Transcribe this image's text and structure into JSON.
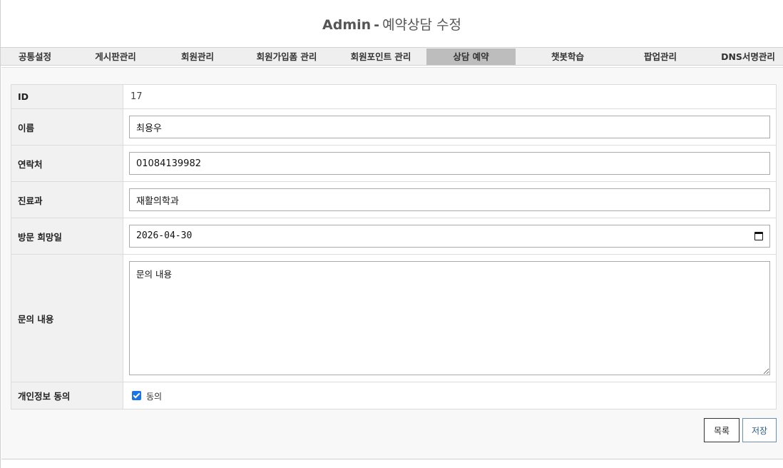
{
  "header": {
    "brand": "Admin",
    "separator": "-",
    "title": "예약상담 수정"
  },
  "nav": [
    {
      "label": "공통설정"
    },
    {
      "label": "게시판관리"
    },
    {
      "label": "회원관리"
    },
    {
      "label": "회원가입폼 관리"
    },
    {
      "label": "회원포인트 관리"
    },
    {
      "label": "상담 예약",
      "active": true
    },
    {
      "label": "챗봇학습"
    },
    {
      "label": "팝업관리"
    },
    {
      "label": "DNS서명관리"
    }
  ],
  "form": {
    "id": {
      "label": "ID",
      "value": "17"
    },
    "name": {
      "label": "이름",
      "value": "최용우"
    },
    "phone": {
      "label": "연락처",
      "value": "01084139982"
    },
    "department": {
      "label": "진료과",
      "value": "재활의학과"
    },
    "visit_date": {
      "label": "방문 희망일",
      "value": "2026-04-30"
    },
    "inquiry": {
      "label": "문의 내용",
      "value": "문의 내용"
    },
    "privacy": {
      "label": "개인정보 동의",
      "checkbox_label": "동의",
      "checked": true
    }
  },
  "buttons": {
    "list": "목록",
    "save": "저장"
  }
}
